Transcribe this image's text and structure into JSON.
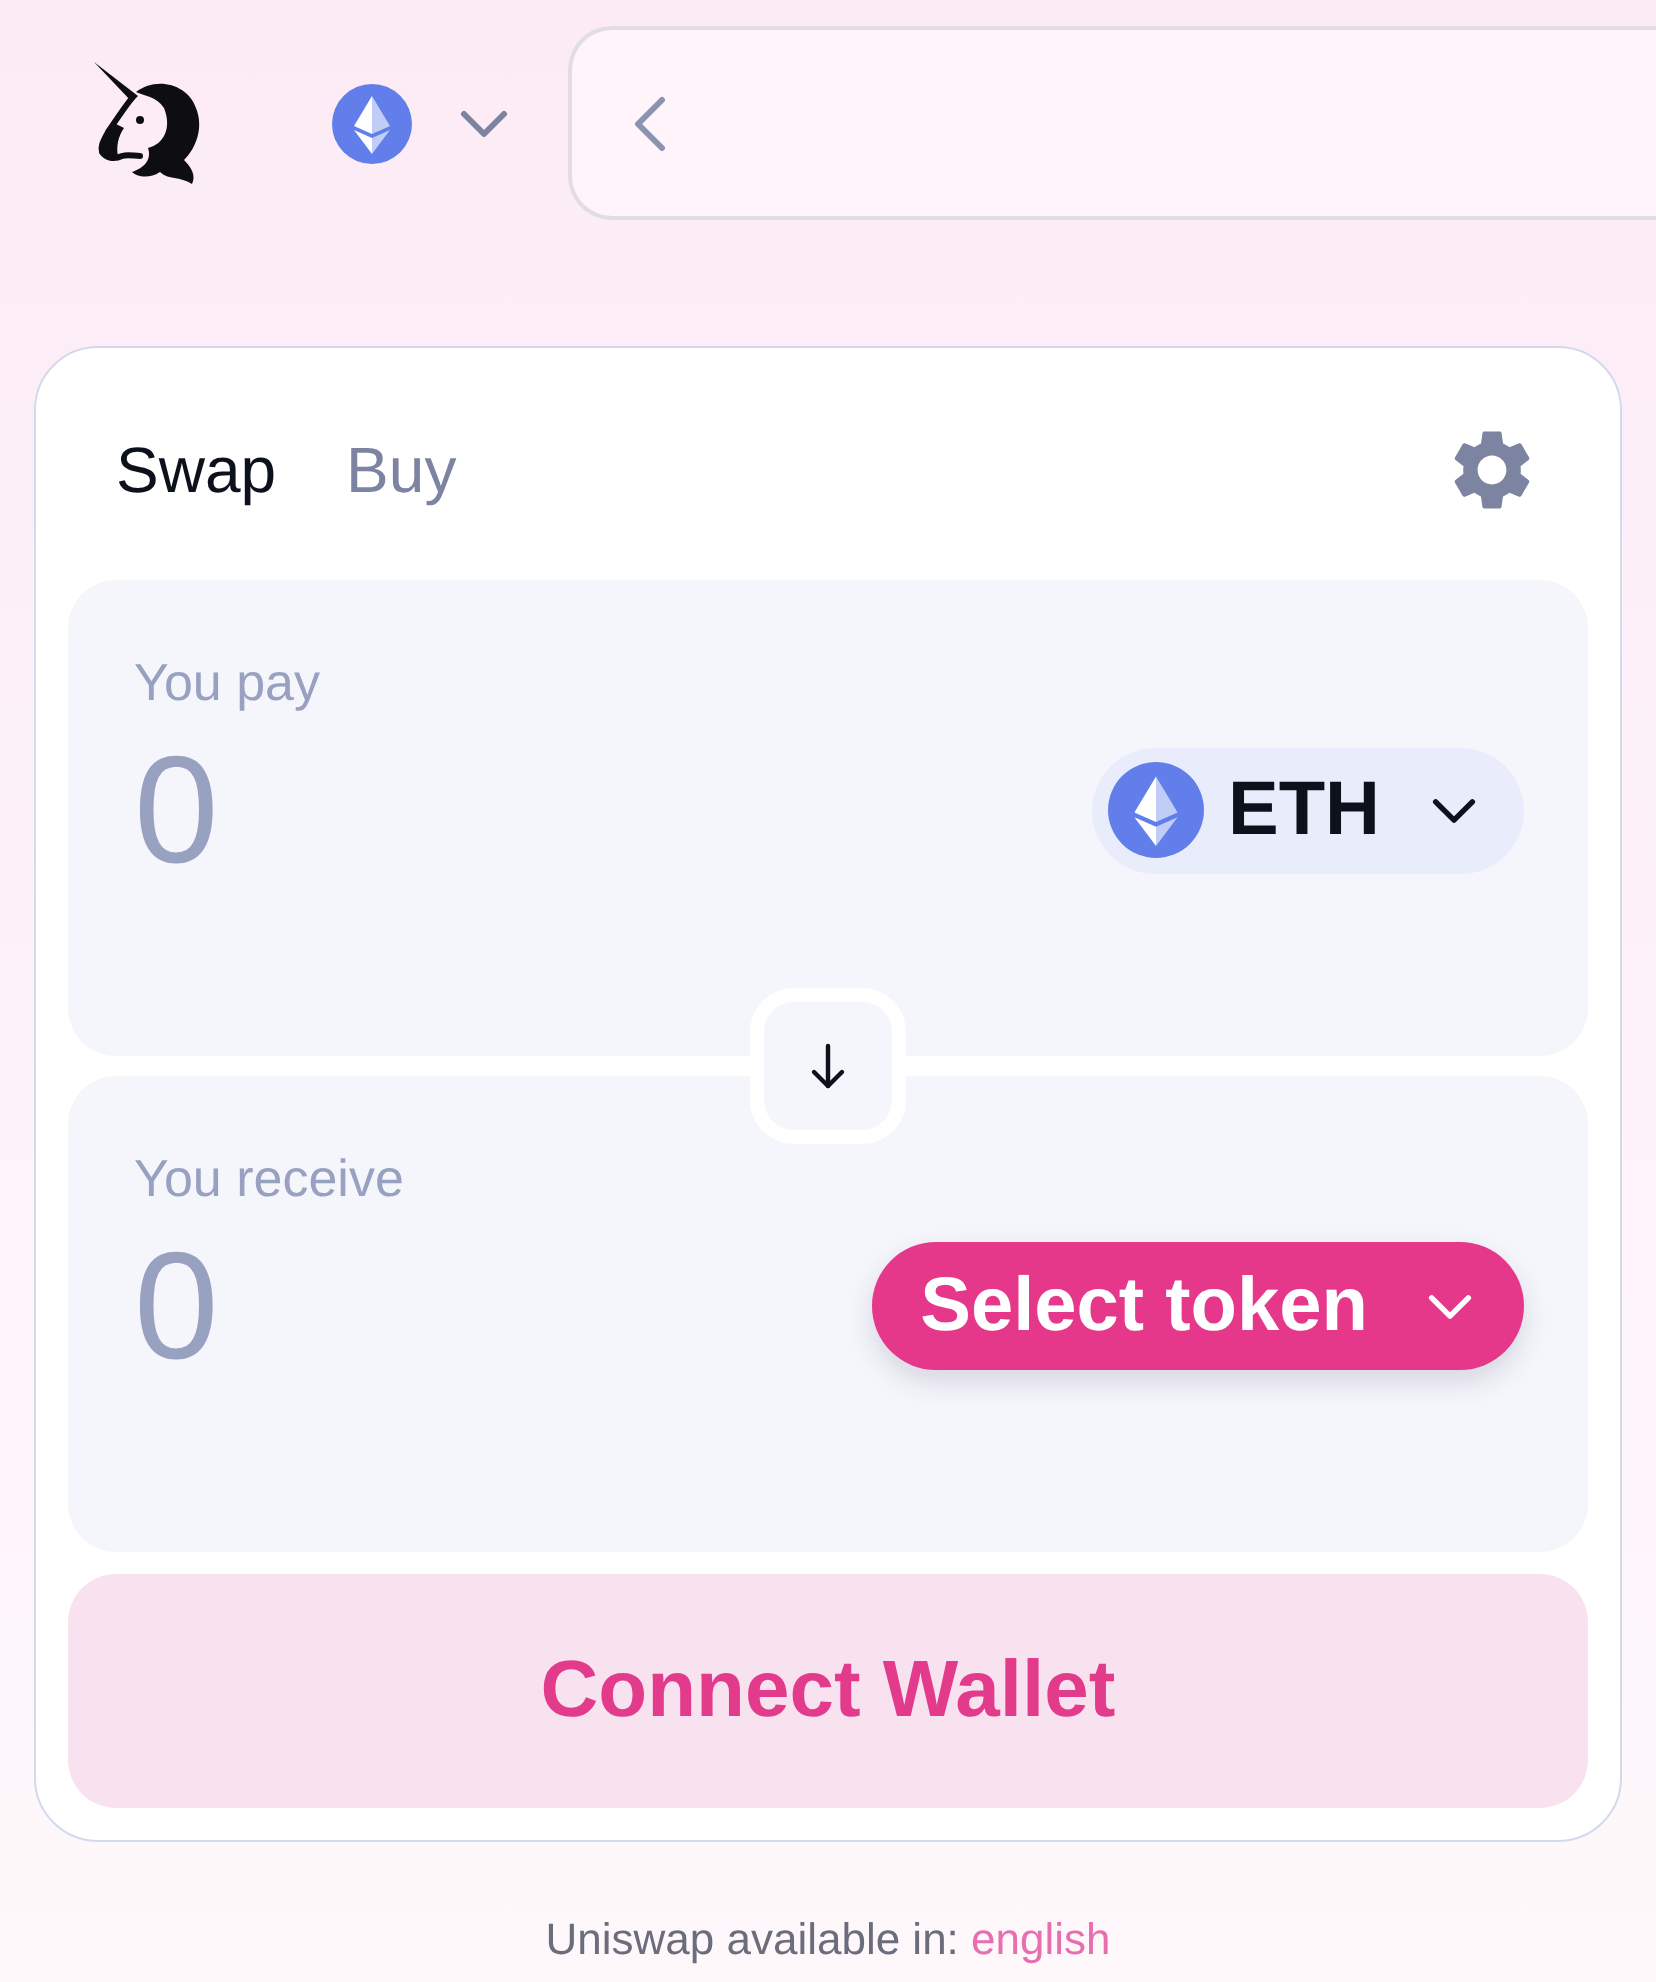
{
  "tabs": [
    {
      "label": "Swap",
      "selected": true
    },
    {
      "label": "Buy",
      "selected": false
    }
  ],
  "panels": [
    {
      "label": "You pay",
      "amount": {
        "placeholder": "0"
      },
      "token": {
        "kind": "token",
        "symbol": "ETH"
      }
    },
    {
      "label": "You receive",
      "amount": {
        "placeholder": "0"
      },
      "token": {
        "kind": "select",
        "label": "Select token"
      }
    }
  ],
  "connect_button": {
    "label": "Connect Wallet"
  },
  "footer": {
    "text": "Uniswap available in:",
    "link": "english"
  }
}
